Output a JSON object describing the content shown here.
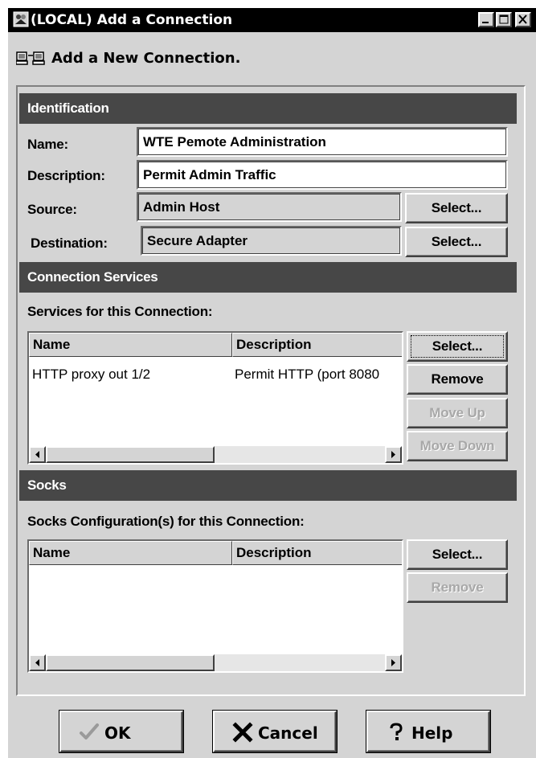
{
  "window": {
    "title": "(LOCAL) Add a Connection",
    "icon": "app-window-icon",
    "controls": [
      "minimize",
      "maximize",
      "close"
    ]
  },
  "header": {
    "icon": "network-computers-icon",
    "text": "Add a New Connection."
  },
  "identification": {
    "section_title": "Identification",
    "name_label": "Name:",
    "name_value": "WTE Pemote Administration",
    "description_label": "Description:",
    "description_value": "Permit Admin Traffic",
    "source_label": "Source:",
    "source_value": "Admin Host",
    "source_select": "Select...",
    "destination_label": "Destination:",
    "destination_value": "Secure Adapter",
    "destination_select": "Select..."
  },
  "services": {
    "section_title": "Connection Services",
    "list_label": "Services for this Connection:",
    "columns": [
      "Name",
      "Description"
    ],
    "rows": [
      {
        "name": "HTTP proxy out 1/2",
        "description": "Permit HTTP (port 8080"
      }
    ],
    "buttons": {
      "select": "Select...",
      "remove": "Remove",
      "move_up": "Move Up",
      "move_down": "Move Down"
    }
  },
  "socks": {
    "section_title": "Socks",
    "list_label": "Socks Configuration(s) for this Connection:",
    "columns": [
      "Name",
      "Description"
    ],
    "rows": [],
    "buttons": {
      "select": "Select...",
      "remove": "Remove"
    }
  },
  "footer": {
    "ok": "OK",
    "cancel": "Cancel",
    "help": "Help"
  },
  "colors": {
    "section_header_bg": "#474747",
    "window_bg": "#d4d4d4",
    "titlebar_bg": "#000000"
  }
}
